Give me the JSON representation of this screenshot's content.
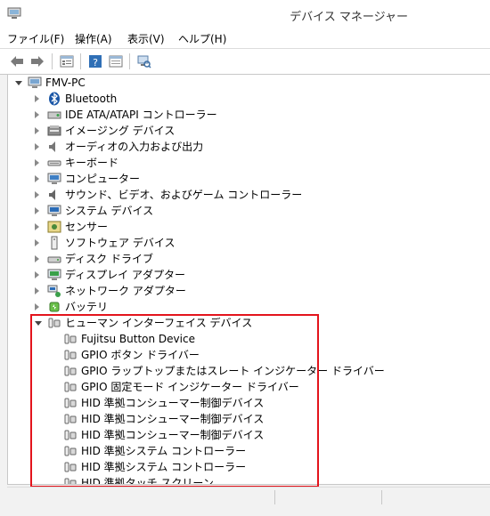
{
  "window": {
    "title": "デバイス マネージャー"
  },
  "menu": [
    {
      "label": "ファイル(F)",
      "name": "menu-file"
    },
    {
      "label": "操作(A)",
      "name": "menu-action"
    },
    {
      "label": "表示(V)",
      "name": "menu-view"
    },
    {
      "label": "ヘルプ(H)",
      "name": "menu-help"
    }
  ],
  "toolbar": {
    "buttons": [
      "back-arrow-icon",
      "forward-arrow-icon",
      "properties-icon",
      "help-icon",
      "show-hide-icon",
      "scan-hardware-icon"
    ]
  },
  "tree": {
    "root": {
      "label": "FMV-PC",
      "icon": "computer-icon"
    },
    "categories": [
      {
        "label": "Bluetooth",
        "icon": "bluetooth-icon"
      },
      {
        "label": "IDE ATA/ATAPI コントローラー",
        "icon": "ide-controller-icon"
      },
      {
        "label": "イメージング デバイス",
        "icon": "imaging-device-icon"
      },
      {
        "label": "オーディオの入力および出力",
        "icon": "audio-icon"
      },
      {
        "label": "キーボード",
        "icon": "keyboard-icon"
      },
      {
        "label": "コンピューター",
        "icon": "computer-icon"
      },
      {
        "label": "サウンド、ビデオ、およびゲーム コントローラー",
        "icon": "sound-icon"
      },
      {
        "label": "システム デバイス",
        "icon": "system-device-icon"
      },
      {
        "label": "センサー",
        "icon": "sensor-icon"
      },
      {
        "label": "ソフトウェア デバイス",
        "icon": "software-device-icon"
      },
      {
        "label": "ディスク ドライブ",
        "icon": "disk-drive-icon"
      },
      {
        "label": "ディスプレイ アダプター",
        "icon": "display-adapter-icon"
      },
      {
        "label": "ネットワーク アダプター",
        "icon": "network-adapter-icon"
      },
      {
        "label": "バッテリ",
        "icon": "battery-icon"
      }
    ],
    "expanded_category": {
      "label": "ヒューマン インターフェイス デバイス",
      "icon": "hid-icon"
    },
    "children": [
      "Fujitsu Button Device",
      "GPIO ボタン ドライバー",
      "GPIO ラップトップまたはスレート インジケーター ドライバー",
      "GPIO 固定モード インジケーター ドライバー",
      "HID 準拠コンシューマー制御デバイス",
      "HID 準拠コンシューマー制御デバイス",
      "HID 準拠コンシューマー制御デバイス",
      "HID 準拠システム コントローラー",
      "HID 準拠システム コントローラー",
      "HID 準拠タッチ スクリーン"
    ]
  },
  "colors": {
    "highlight_border": "#e3141c"
  }
}
